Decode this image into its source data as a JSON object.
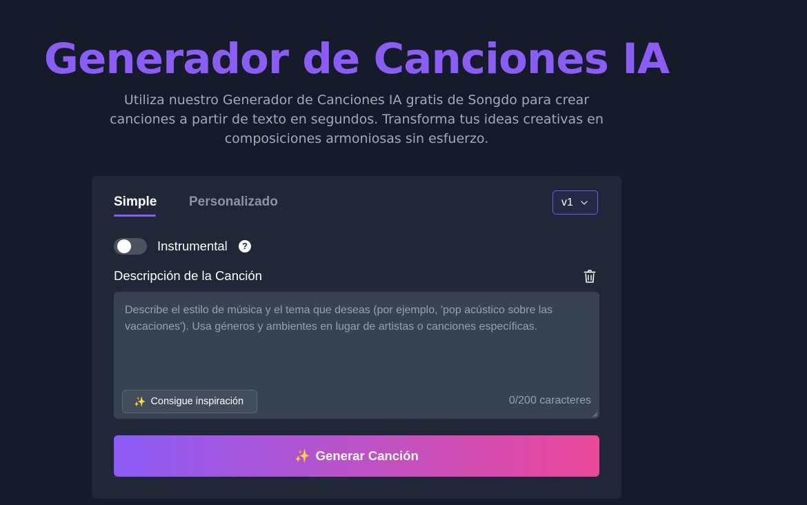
{
  "hero": {
    "title": "Generador de Canciones IA",
    "subtitle": "Utiliza nuestro Generador de Canciones IA gratis de Songdo para crear canciones a partir de texto en segundos. Transforma tus ideas creativas en composiciones armoniosas sin esfuerzo."
  },
  "tabs": [
    {
      "label": "Simple",
      "active": true
    },
    {
      "label": "Personalizado",
      "active": false
    }
  ],
  "version_select": {
    "value": "v1",
    "icon": "chevron-down-icon"
  },
  "instrumental": {
    "label": "Instrumental",
    "enabled": false,
    "help_icon": "question-circle-icon"
  },
  "description": {
    "label": "Descripción de la Canción",
    "clear_icon": "trash-icon",
    "value": "",
    "placeholder": "Describe el estilo de música y el tema que deseas (por ejemplo, 'pop acústico sobre las vacaciones'). Usa géneros y ambientes en lugar de artistas o canciones específicas.",
    "char_count": "0/200 caracteres",
    "inspire_button": {
      "icon": "✨",
      "label": "Consigue inspiración"
    }
  },
  "generate_button": {
    "icon": "✨",
    "label": "Generar Canción"
  },
  "colors": {
    "background": "#151b29",
    "card": "#1f2738",
    "accent": "#8b5cf6",
    "gradient_end": "#ec4899",
    "textarea_bg": "#384252"
  }
}
